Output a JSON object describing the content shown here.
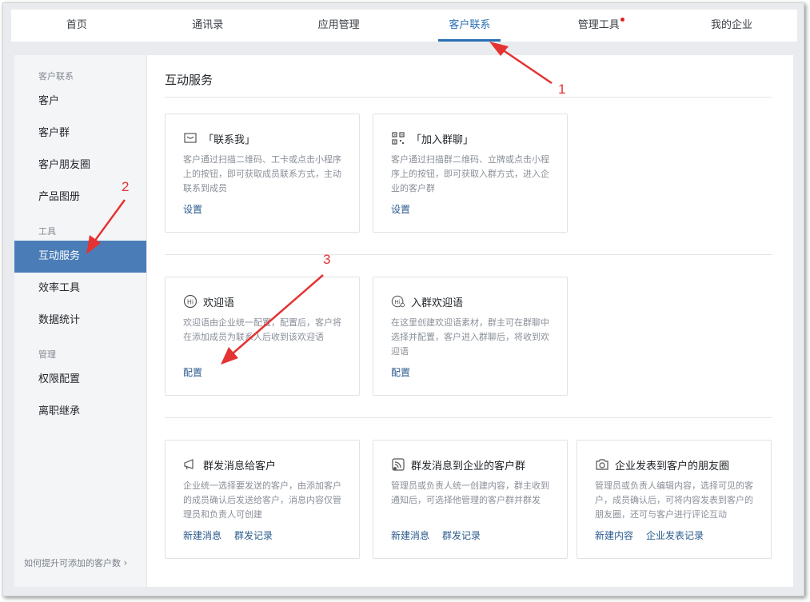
{
  "topnav": {
    "tabs": [
      {
        "label": "首页"
      },
      {
        "label": "通讯录"
      },
      {
        "label": "应用管理"
      },
      {
        "label": "客户联系"
      },
      {
        "label": "管理工具"
      },
      {
        "label": "我的企业"
      }
    ],
    "active_tab": "客户联系"
  },
  "sidebar": {
    "groups": [
      {
        "label": "客户联系",
        "items": [
          "客户",
          "客户群",
          "客户朋友圈",
          "产品图册"
        ]
      },
      {
        "label": "工具",
        "items": [
          "互动服务",
          "效率工具",
          "数据统计"
        ]
      },
      {
        "label": "管理",
        "items": [
          "权限配置",
          "离职继承"
        ]
      }
    ],
    "active_item": "互动服务",
    "footer": "如何提升可添加的客户数"
  },
  "main": {
    "title": "互动服务",
    "cards": [
      {
        "title": "「联系我」",
        "icon": "message-icon",
        "desc": "客户通过扫描二维码、工卡或点击小程序上的按钮，即可获取成员联系方式，主动联系到成员",
        "links": [
          "设置"
        ]
      },
      {
        "title": "「加入群聊」",
        "icon": "qr-code-icon",
        "desc": "客户通过扫描群二维码、立牌或点击小程序上的按钮，即可获取入群方式，进入企业的客户群",
        "links": [
          "设置"
        ]
      },
      {
        "title": "欢迎语",
        "icon": "hi-icon",
        "desc": "欢迎语由企业统一配置，配置后，客户将在添加成员为联系人后收到该欢迎语",
        "links": [
          "配置"
        ]
      },
      {
        "title": "入群欢迎语",
        "icon": "group-hi-icon",
        "desc": "在这里创建欢迎语素材，群主可在群聊中选择并配置，客户进入群聊后，将收到欢迎语",
        "links": [
          "配置"
        ]
      },
      {
        "title": "群发消息给客户",
        "icon": "megaphone-icon",
        "desc": "企业统一选择要发送的客户，由添加客户的成员确认后发送给客户，消息内容仅管理员和负责人可创建",
        "links": [
          "新建消息",
          "群发记录"
        ]
      },
      {
        "title": "群发消息到企业的客户群",
        "icon": "broadcast-icon",
        "desc": "管理员或负责人统一创建内容，群主收到通知后，可选择他管理的客户群并群发",
        "links": [
          "新建消息",
          "群发记录"
        ]
      },
      {
        "title": "企业发表到客户的朋友圈",
        "icon": "camera-icon",
        "desc": "管理员或负责人编辑内容，选择可见的客户，成员确认后，可将内容发表到客户的朋友圈，还可与客户进行评论互动",
        "links": [
          "新建内容",
          "企业发表记录"
        ]
      }
    ]
  },
  "annotations": {
    "numbers": [
      "1",
      "2",
      "3"
    ],
    "color": "#e53232"
  }
}
